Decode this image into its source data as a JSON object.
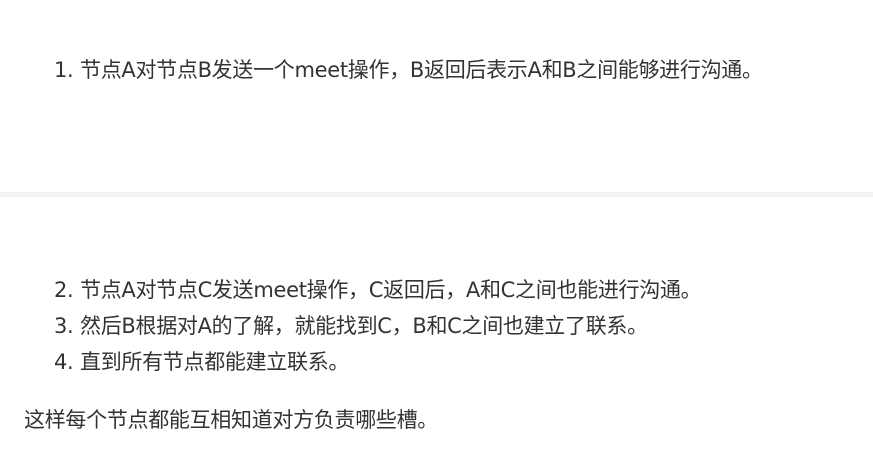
{
  "steps_top": [
    {
      "num": "1.",
      "text": "节点A对节点B发送一个meet操作，B返回后表示A和B之间能够进行沟通。"
    }
  ],
  "steps_bottom": [
    {
      "num": "2.",
      "text": "节点A对节点C发送meet操作，C返回后，A和C之间也能进行沟通。"
    },
    {
      "num": "3.",
      "text": "然后B根据对A的了解，就能找到C，B和C之间也建立了联系。"
    },
    {
      "num": "4.",
      "text": "直到所有节点都能建立联系。"
    }
  ],
  "summary": "这样每个节点都能互相知道对方负责哪些槽。"
}
